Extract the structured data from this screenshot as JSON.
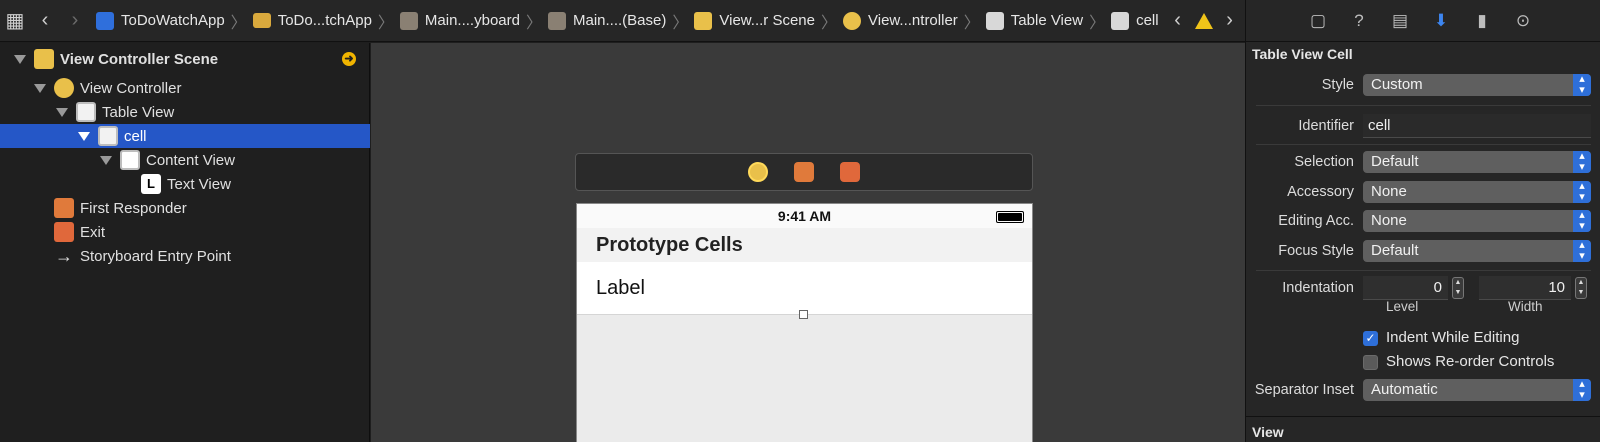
{
  "jumpbar": {
    "crumbs": [
      {
        "label": "ToDoWatchApp",
        "icon": "xcode-project-icon"
      },
      {
        "label": "ToDo...tchApp",
        "icon": "folder-icon"
      },
      {
        "label": "Main....yboard",
        "icon": "storyboard-icon"
      },
      {
        "label": "Main....(Base)",
        "icon": "storyboard-icon"
      },
      {
        "label": "View...r Scene",
        "icon": "scene-icon"
      },
      {
        "label": "View...ntroller",
        "icon": "view-controller-icon"
      },
      {
        "label": "Table View",
        "icon": "table-view-icon"
      },
      {
        "label": "cell",
        "icon": "table-cell-icon"
      }
    ]
  },
  "outline": {
    "scene": "View Controller Scene",
    "items": [
      {
        "label": "View Controller"
      },
      {
        "label": "Table View"
      },
      {
        "label": "cell"
      },
      {
        "label": "Content View"
      },
      {
        "label": "Text View",
        "glyph": "L"
      },
      {
        "label": "First Responder"
      },
      {
        "label": "Exit"
      },
      {
        "label": "Storyboard Entry Point"
      }
    ]
  },
  "canvas": {
    "time": "9:41 AM",
    "section_header": "Prototype Cells",
    "cell_label": "Label"
  },
  "inspector": {
    "section_title": "Table View Cell",
    "style": {
      "label": "Style",
      "value": "Custom"
    },
    "identifier": {
      "label": "Identifier",
      "value": "cell"
    },
    "selection": {
      "label": "Selection",
      "value": "Default"
    },
    "accessory": {
      "label": "Accessory",
      "value": "None"
    },
    "editing_acc": {
      "label": "Editing Acc.",
      "value": "None"
    },
    "focus_style": {
      "label": "Focus Style",
      "value": "Default"
    },
    "indentation": {
      "label": "Indentation",
      "level": "0",
      "width": "10",
      "level_label": "Level",
      "width_label": "Width"
    },
    "indent_while_editing": {
      "label": "Indent While Editing",
      "checked": true
    },
    "shows_reorder": {
      "label": "Shows Re-order Controls",
      "checked": false
    },
    "separator_inset": {
      "label": "Separator Inset",
      "value": "Automatic"
    },
    "next_section": "View"
  },
  "colors": {
    "selection": "#2557c7",
    "accent": "#2e6fd9",
    "warning": "#f0c419",
    "scene_icon": "#e9c04a",
    "responder_icon": "#e07a3b"
  }
}
